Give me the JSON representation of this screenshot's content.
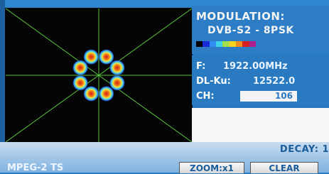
{
  "modulation": {
    "title": "MODULATION:",
    "value": "DVB-S2 - 8PSK",
    "scale_colors": [
      "#000000",
      "#1a2bd8",
      "#2f8cf2",
      "#3fd0ea",
      "#a4e04a",
      "#f6d21c",
      "#f08c1a",
      "#d81f1f",
      "#b01f8f"
    ]
  },
  "params": {
    "f_label": "F:",
    "f_value": "1922.00MHz",
    "dl_label": "DL-Ku:",
    "dl_value": "12522.0",
    "ch_label": "CH:",
    "ch_value": "106"
  },
  "footer": {
    "decay_label": "DECAY: 1",
    "stream_label": "MPEG-2 TS",
    "zoom_label": "ZOOM:x1",
    "clear_label": "CLEAR"
  },
  "constellation": {
    "points": 8,
    "grid_color": "#58c23a"
  }
}
